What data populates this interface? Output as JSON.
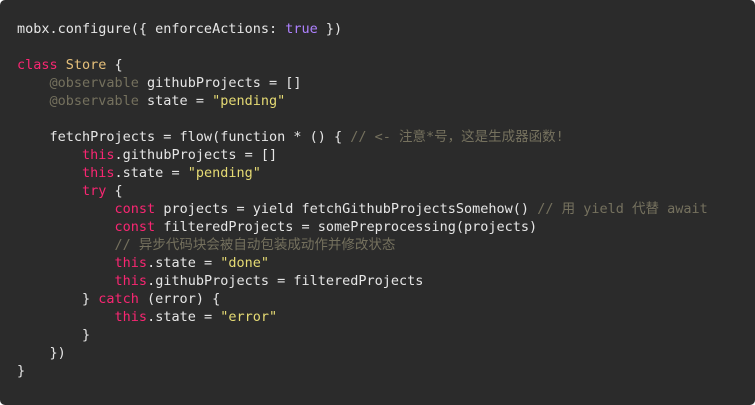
{
  "colors": {
    "background": "#2b2b2b",
    "plain": "#e6e6e6",
    "keyword": "#f92672",
    "builtin": "#ae81ff",
    "class_name": "#e6c07b",
    "string": "#e6db74",
    "comment": "#75715e"
  },
  "lines": [
    [
      {
        "t": "plain",
        "v": "mobx.configure({ enforceActions: "
      },
      {
        "t": "builtin",
        "v": "true"
      },
      {
        "t": "plain",
        "v": " })"
      }
    ],
    [],
    [
      {
        "t": "kw",
        "v": "class"
      },
      {
        "t": "plain",
        "v": " "
      },
      {
        "t": "class",
        "v": "Store"
      },
      {
        "t": "plain",
        "v": " {"
      }
    ],
    [
      {
        "t": "plain",
        "v": "    "
      },
      {
        "t": "decorator",
        "v": "@observable"
      },
      {
        "t": "plain",
        "v": " githubProjects = []"
      }
    ],
    [
      {
        "t": "plain",
        "v": "    "
      },
      {
        "t": "decorator",
        "v": "@observable"
      },
      {
        "t": "plain",
        "v": " state = "
      },
      {
        "t": "str",
        "v": "\"pending\""
      }
    ],
    [],
    [
      {
        "t": "plain",
        "v": "    fetchProjects = flow(function * () { "
      },
      {
        "t": "comment",
        "v": "// <- 注意*号，这是生成器函数!"
      }
    ],
    [
      {
        "t": "plain",
        "v": "        "
      },
      {
        "t": "kw",
        "v": "this"
      },
      {
        "t": "plain",
        "v": ".githubProjects = []"
      }
    ],
    [
      {
        "t": "plain",
        "v": "        "
      },
      {
        "t": "kw",
        "v": "this"
      },
      {
        "t": "plain",
        "v": ".state = "
      },
      {
        "t": "str",
        "v": "\"pending\""
      }
    ],
    [
      {
        "t": "plain",
        "v": "        "
      },
      {
        "t": "kw",
        "v": "try"
      },
      {
        "t": "plain",
        "v": " {"
      }
    ],
    [
      {
        "t": "plain",
        "v": "            "
      },
      {
        "t": "kw",
        "v": "const"
      },
      {
        "t": "plain",
        "v": " projects = yield fetchGithubProjectsSomehow() "
      },
      {
        "t": "comment",
        "v": "// 用 yield 代替 await"
      }
    ],
    [
      {
        "t": "plain",
        "v": "            "
      },
      {
        "t": "kw",
        "v": "const"
      },
      {
        "t": "plain",
        "v": " filteredProjects = somePreprocessing(projects)"
      }
    ],
    [
      {
        "t": "plain",
        "v": "            "
      },
      {
        "t": "comment",
        "v": "// 异步代码块会被自动包装成动作并修改状态"
      }
    ],
    [
      {
        "t": "plain",
        "v": "            "
      },
      {
        "t": "kw",
        "v": "this"
      },
      {
        "t": "plain",
        "v": ".state = "
      },
      {
        "t": "str",
        "v": "\"done\""
      }
    ],
    [
      {
        "t": "plain",
        "v": "            "
      },
      {
        "t": "kw",
        "v": "this"
      },
      {
        "t": "plain",
        "v": ".githubProjects = filteredProjects"
      }
    ],
    [
      {
        "t": "plain",
        "v": "        } "
      },
      {
        "t": "kw",
        "v": "catch"
      },
      {
        "t": "plain",
        "v": " (error) {"
      }
    ],
    [
      {
        "t": "plain",
        "v": "            "
      },
      {
        "t": "kw",
        "v": "this"
      },
      {
        "t": "plain",
        "v": ".state = "
      },
      {
        "t": "str",
        "v": "\"error\""
      }
    ],
    [
      {
        "t": "plain",
        "v": "        }"
      }
    ],
    [
      {
        "t": "plain",
        "v": "    })"
      }
    ],
    [
      {
        "t": "plain",
        "v": "}"
      }
    ]
  ]
}
